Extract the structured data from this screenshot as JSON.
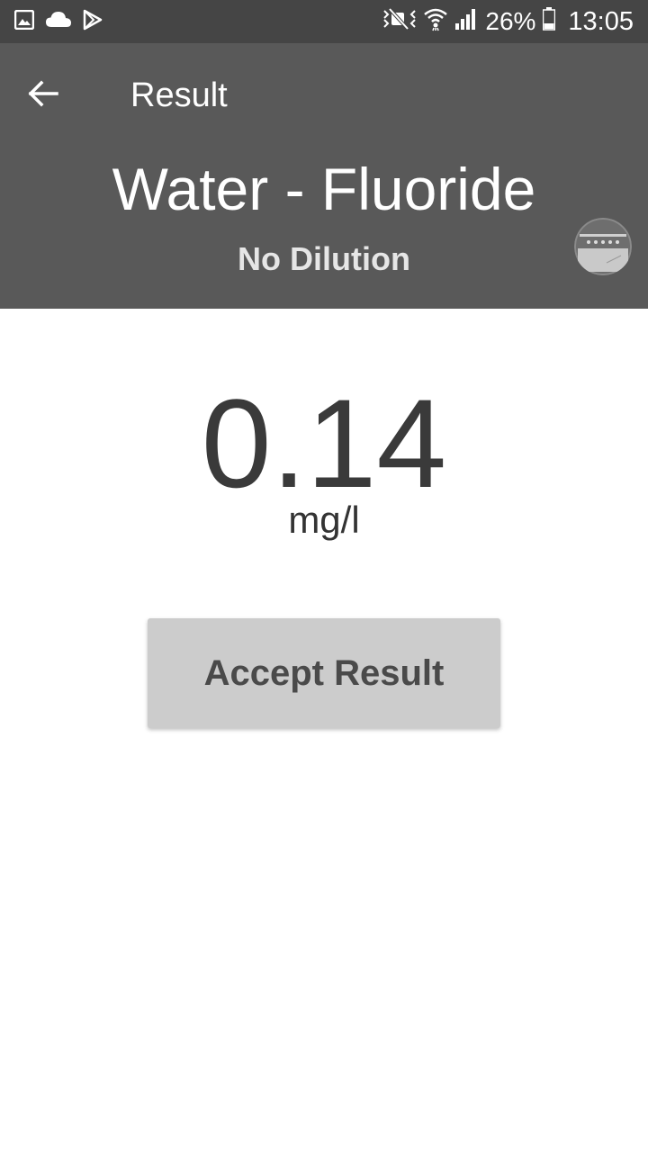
{
  "status_bar": {
    "icons_left": [
      "gallery-icon",
      "cloud-icon",
      "play-store-icon"
    ],
    "icons_right": [
      "mute-icon",
      "wifi-icon",
      "signal-icon",
      "battery-icon"
    ],
    "battery": "26%",
    "time": "13:05"
  },
  "toolbar": {
    "back_icon": "arrow-left-icon",
    "title": "Result"
  },
  "header": {
    "test_name": "Water - Fluoride",
    "dilution": "No Dilution"
  },
  "result": {
    "value": "0.14",
    "unit": "mg/l"
  },
  "actions": {
    "accept_label": "Accept Result"
  },
  "colors": {
    "status_bar_bg": "#454545",
    "app_bar_bg": "#595959",
    "button_bg": "#cccccc",
    "result_text": "#3a3a3a"
  }
}
